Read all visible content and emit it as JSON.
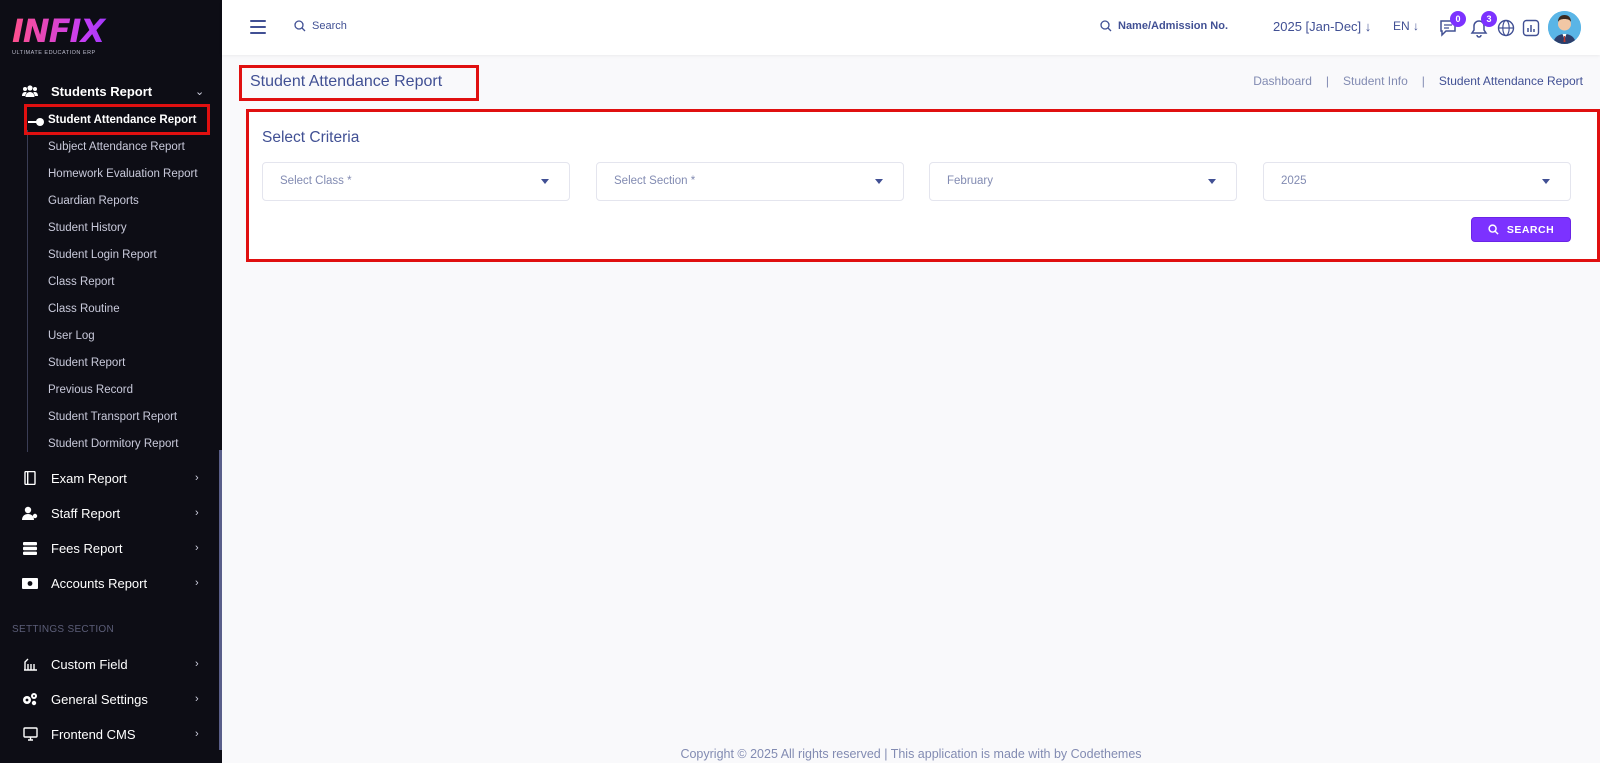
{
  "brand": {
    "logo_text": "INFIX",
    "tagline": "ULTIMATE EDUCATION ERP"
  },
  "topbar": {
    "search_label": "Search",
    "student_search_label": "Name/Admission No.",
    "year": "2025 [Jan-Dec]",
    "language": "EN",
    "messages_count": "0",
    "notifications_count": "3"
  },
  "sidebar": {
    "open_group": {
      "label": "Students Report",
      "icon": "users-icon"
    },
    "sub_items": [
      "Student Attendance Report",
      "Subject Attendance Report",
      "Homework Evaluation Report",
      "Guardian Reports",
      "Student History",
      "Student Login Report",
      "Class Report",
      "Class Routine",
      "User Log",
      "Student Report",
      "Previous Record",
      "Student Transport Report",
      "Student Dormitory Report"
    ],
    "groups": [
      {
        "label": "Exam Report",
        "icon": "book-icon"
      },
      {
        "label": "Staff Report",
        "icon": "user-icon"
      },
      {
        "label": "Fees Report",
        "icon": "database-icon"
      },
      {
        "label": "Accounts Report",
        "icon": "money-icon"
      }
    ],
    "settings_section_label": "SETTINGS SECTION",
    "settings_groups": [
      {
        "label": "Custom Field",
        "icon": "field-icon"
      },
      {
        "label": "General Settings",
        "icon": "gears-icon"
      },
      {
        "label": "Frontend CMS",
        "icon": "monitor-icon"
      }
    ]
  },
  "page": {
    "title": "Student Attendance Report",
    "breadcrumb": [
      "Dashboard",
      "Student Info",
      "Student Attendance Report"
    ]
  },
  "criteria": {
    "title": "Select Criteria",
    "class_placeholder": "Select Class *",
    "section_placeholder": "Select Section *",
    "month": "February",
    "year": "2025",
    "search_button": "SEARCH"
  },
  "footer": "Copyright © 2025 All rights reserved | This application is made with by Codethemes",
  "colors": {
    "accent": "#7c32ff",
    "sidebar_bg": "#0d0d15",
    "highlight": "#e01010",
    "text_primary": "#415094"
  }
}
